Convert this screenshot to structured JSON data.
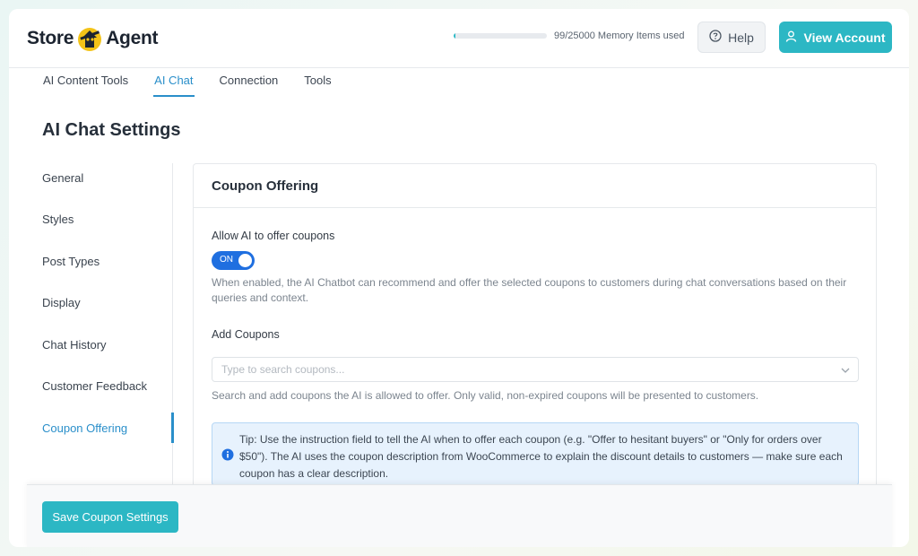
{
  "brand": {
    "name_part1": "Store",
    "name_part2": "Agent"
  },
  "header": {
    "memory_label": "99/25000 Memory Items used",
    "memory_used_fraction": 0.00396,
    "help_label": "Help",
    "account_label": "View Account"
  },
  "tabs": [
    {
      "label": "AI Content Tools",
      "active": false
    },
    {
      "label": "AI Chat",
      "active": true
    },
    {
      "label": "Connection",
      "active": false
    },
    {
      "label": "Tools",
      "active": false
    }
  ],
  "page_title": "AI Chat Settings",
  "sidebar": {
    "items": [
      {
        "label": "General"
      },
      {
        "label": "Styles"
      },
      {
        "label": "Post Types"
      },
      {
        "label": "Display"
      },
      {
        "label": "Chat History"
      },
      {
        "label": "Customer Feedback"
      },
      {
        "label": "Coupon Offering",
        "active": true
      }
    ]
  },
  "coupon": {
    "section_title": "Coupon Offering",
    "allow_label": "Allow AI to offer coupons",
    "toggle_label": "ON",
    "toggle_on": true,
    "allow_help": "When enabled, the AI Chatbot can recommend and offer the selected coupons to customers during chat conversations based on their queries and context.",
    "add_label": "Add Coupons",
    "search_placeholder": "Type to search coupons...",
    "search_help": "Search and add coupons the AI is allowed to offer. Only valid, non-expired coupons will be presented to customers.",
    "tip": "Tip: Use the instruction field to tell the AI when to offer each coupon (e.g. \"Offer to hesitant buyers\" or \"Only for orders over $50\"). The AI uses the coupon description from WooCommerce to explain the discount details to customers — make sure each coupon has a clear description."
  },
  "footer": {
    "save_label": "Save Coupon Settings"
  },
  "colors": {
    "accent": "#2cb7c4",
    "link": "#2a8fca",
    "toggle": "#1f6fe0",
    "tip_bg": "#e7f2fd"
  },
  "icons": {
    "help": "question-circle-icon",
    "account": "user-icon",
    "chevron": "chevron-down-icon",
    "info": "info-icon"
  }
}
